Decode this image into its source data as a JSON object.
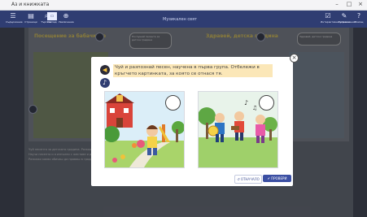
{
  "window": {
    "title": "Аз и книжката"
  },
  "toolbar": {
    "title": "Музикален свят",
    "buttons": [
      {
        "label": "Съдържание",
        "icon": "menu-icon"
      },
      {
        "label": "Страници",
        "icon": "pages-icon"
      },
      {
        "label": "Търсене",
        "icon": "search-icon"
      },
      {
        "label": "Изглед",
        "icon": "view-icon"
      },
      {
        "label": "Увеличение",
        "icon": "zoom-icon"
      },
      {
        "label": "Интерактивни упражнения",
        "icon": "exercise-icon"
      },
      {
        "label": "Бележки",
        "icon": "notes-icon"
      },
      {
        "label": "Помощ",
        "icon": "help-icon"
      }
    ]
  },
  "page": {
    "left_title": "Посещение за бабачките",
    "right_title": "Здравей, детска градина",
    "left_bubble": "Послушай песента за детска градина",
    "right_bubble": "Здравей, детска градина",
    "lines": [
      "Чуй песента за детската градина. Разкажи какво виждаш.",
      "Научи песента и я изпълни с жестове и движения.",
      "Разкажи какво обичаш да правиш в градината."
    ]
  },
  "modal": {
    "instruction": "Чуй и разпознай песен, научена в първа група. Отбележи в кръгчето картинката, за която се отнася тя.",
    "reset_label": "↺ ОТНАЧАЛО",
    "check_label": "✔ ПРОВЕРИ",
    "close_glyph": "×"
  }
}
